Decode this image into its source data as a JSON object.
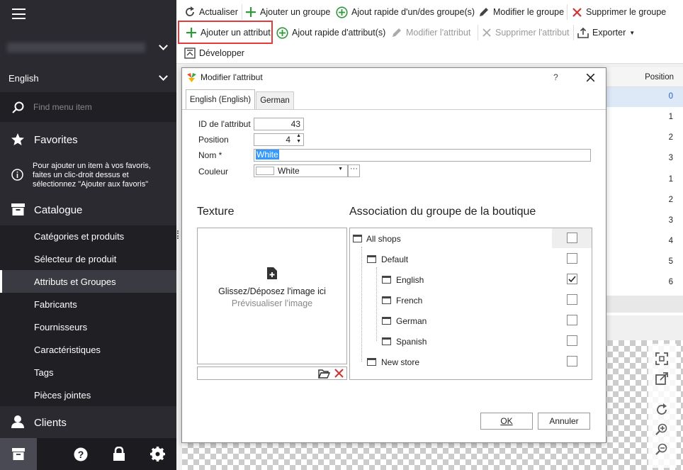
{
  "sidebar": {
    "language": "English",
    "search_placeholder": "Find menu item",
    "favorites": "Favorites",
    "favorites_hint": "Pour ajouter un item à vos favoris, faites un clic-droit dessus et sélectionnez \"Ajouter aux favoris\"",
    "catalogue": "Catalogue",
    "items": [
      "Catégories et produits",
      "Sélecteur de produit",
      "Attributs et Groupes",
      "Fabricants",
      "Fournisseurs",
      "Caractéristiques",
      "Tags",
      "Pièces jointes"
    ],
    "clients": "Clients"
  },
  "toolbar": {
    "refresh": "Actualiser",
    "add_group": "Ajouter un groupe",
    "quick_add_group": "Ajout rapide d'un/des groupe(s)",
    "edit_group": "Modifier le groupe",
    "delete_group": "Supprimer le groupe",
    "add_attribute": "Ajouter un attribut",
    "quick_add_attribute": "Ajout rapide d'attribut(s)",
    "edit_attribute": "Modifier l'attribut",
    "delete_attribute": "Supprimer l'attribut",
    "export": "Exporter",
    "expand": "Développer"
  },
  "grid": {
    "header": "Position",
    "values": [
      "0",
      "1",
      "2",
      "3",
      "1",
      "2",
      "3",
      "4",
      "5",
      "6"
    ]
  },
  "dialog": {
    "title": "Modifier l'attribut",
    "help": "?",
    "tabs": [
      "English (English)",
      "German"
    ],
    "id_label": "ID de l'attribut",
    "id_value": "43",
    "position_label": "Position",
    "position_value": "4",
    "name_label": "Nom *",
    "name_value": "White",
    "color_label": "Couleur",
    "color_value": "White",
    "color_swatch": "#ffffff",
    "texture_title": "Texture",
    "drop_text": "Glissez/Déposez l'image ici",
    "preview_text": "Prévisualiser l'image",
    "assoc_title": "Association du groupe de la boutique",
    "tree": [
      {
        "label": "All shops",
        "checked": false
      },
      {
        "label": "Default",
        "checked": false
      },
      {
        "label": "English",
        "checked": true
      },
      {
        "label": "French",
        "checked": false
      },
      {
        "label": "German",
        "checked": false
      },
      {
        "label": "Spanish",
        "checked": false
      },
      {
        "label": "New store",
        "checked": false
      }
    ],
    "ok": "OK",
    "cancel": "Annuler"
  },
  "colors": {
    "sidebar_bg": "#2a2a30",
    "highlight": "#e03c3c",
    "accent": "#1e7fd0",
    "selection": "#3399ff"
  }
}
